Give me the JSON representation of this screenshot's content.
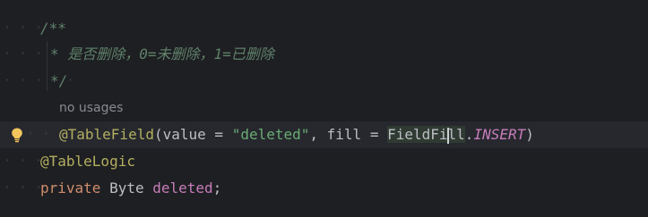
{
  "editor": {
    "lines": [
      {
        "dots": "· · · · ",
        "text": "/**"
      },
      {
        "dots": "· · · · · ",
        "text": "* 是否删除，0=未删除，1=已删除"
      },
      {
        "dots": "· · · · · ",
        "text": "*/"
      },
      {
        "hint": "no usages"
      },
      {
        "dots": "· · · · · ",
        "annotation": "@TableField",
        "open": "(",
        "arg1": "value",
        "eq1": " = ",
        "str": "\"deleted\"",
        "comma": ", ",
        "arg2": "fill",
        "eq2": " = ",
        "class_a": "FieldFi",
        "class_b": "ll",
        "dot": ".",
        "const": "INSERT",
        "close": ")"
      },
      {
        "dots": "· · · · ",
        "text": "@TableLogic"
      },
      {
        "dots": "· · · · ",
        "kw": "private",
        "type": " Byte ",
        "field": "deleted",
        "semi": ";"
      }
    ]
  },
  "colors": {
    "background": "#1e1f22",
    "current_line": "#26282e",
    "comment": "#5f826b",
    "annotation": "#b3ae60",
    "string": "#6aab73",
    "keyword": "#cf8e6d",
    "field": "#c77dbb",
    "bulb": "#f2c55c"
  },
  "icons": {
    "intention": "lightbulb-icon"
  }
}
